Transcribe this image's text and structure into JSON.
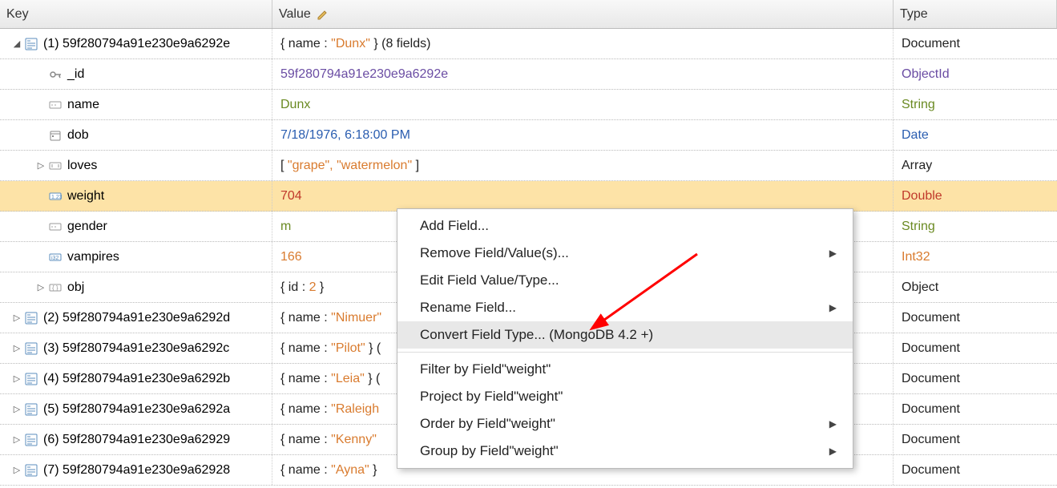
{
  "headers": {
    "key": "Key",
    "value": "Value",
    "type": "Type"
  },
  "rows": [
    {
      "kind": "doc",
      "expander": "down",
      "indent": 0,
      "icon": "doc",
      "key": "(1) 59f280794a91e230e9a6292e",
      "value_pre": "{ name : ",
      "value_q": "\"Dunx\"",
      "value_post": " } (8 fields)",
      "valColor": "txt-black",
      "type": "Document",
      "typeColor": "txt-black"
    },
    {
      "kind": "field",
      "expander": "",
      "indent": 1,
      "icon": "key",
      "key": "_id",
      "value": "59f280794a91e230e9a6292e",
      "valColor": "txt-purple",
      "type": "ObjectId",
      "typeColor": "txt-purple"
    },
    {
      "kind": "field",
      "expander": "",
      "indent": 1,
      "icon": "str",
      "key": "name",
      "value": "Dunx",
      "valColor": "txt-green",
      "type": "String",
      "typeColor": "txt-green"
    },
    {
      "kind": "field",
      "expander": "",
      "indent": 1,
      "icon": "date",
      "key": "dob",
      "value": "7/18/1976, 6:18:00 PM",
      "valColor": "txt-blue",
      "type": "Date",
      "typeColor": "txt-blue"
    },
    {
      "kind": "field",
      "expander": "right",
      "indent": 1,
      "icon": "arr",
      "key": "loves",
      "value_pre": "[ ",
      "value_q": "\"grape\", \"watermelon\"",
      "value_post": " ]",
      "valColor": "txt-black",
      "type": "Array",
      "typeColor": "txt-black"
    },
    {
      "kind": "field",
      "expander": "",
      "indent": 1,
      "icon": "num",
      "key": "weight",
      "value": "704",
      "valColor": "txt-red",
      "type": "Double",
      "typeColor": "txt-red",
      "highlight": true
    },
    {
      "kind": "field",
      "expander": "",
      "indent": 1,
      "icon": "str",
      "key": "gender",
      "value": "m",
      "valColor": "txt-green",
      "type": "String",
      "typeColor": "txt-green"
    },
    {
      "kind": "field",
      "expander": "",
      "indent": 1,
      "icon": "int",
      "key": "vampires",
      "value": "166",
      "valColor": "txt-orange",
      "type": "Int32",
      "typeColor": "txt-orange"
    },
    {
      "kind": "field",
      "expander": "right",
      "indent": 1,
      "icon": "obj",
      "key": "obj",
      "value_pre": "{ id : ",
      "value_q": "2",
      "value_post": " }",
      "valColor": "txt-black",
      "qColor": "txt-orange",
      "type": "Object",
      "typeColor": "txt-black"
    },
    {
      "kind": "doc",
      "expander": "right",
      "indent": 0,
      "icon": "doc",
      "key": "(2) 59f280794a91e230e9a6292d",
      "value_pre": "{ name : ",
      "value_q": "\"Nimuer\"",
      "value_post": "",
      "valColor": "txt-black",
      "type": "Document",
      "typeColor": "txt-black"
    },
    {
      "kind": "doc",
      "expander": "right",
      "indent": 0,
      "icon": "doc",
      "key": "(3) 59f280794a91e230e9a6292c",
      "value_pre": "{ name : ",
      "value_q": "\"Pilot\"",
      "value_post": " } (",
      "valColor": "txt-black",
      "type": "Document",
      "typeColor": "txt-black"
    },
    {
      "kind": "doc",
      "expander": "right",
      "indent": 0,
      "icon": "doc",
      "key": "(4) 59f280794a91e230e9a6292b",
      "value_pre": "{ name : ",
      "value_q": "\"Leia\"",
      "value_post": " } (",
      "valColor": "txt-black",
      "type": "Document",
      "typeColor": "txt-black"
    },
    {
      "kind": "doc",
      "expander": "right",
      "indent": 0,
      "icon": "doc",
      "key": "(5) 59f280794a91e230e9a6292a",
      "value_pre": "{ name : ",
      "value_q": "\"Raleigh",
      "value_post": "",
      "valColor": "txt-black",
      "type": "Document",
      "typeColor": "txt-black"
    },
    {
      "kind": "doc",
      "expander": "right",
      "indent": 0,
      "icon": "doc",
      "key": "(6) 59f280794a91e230e9a62929",
      "value_pre": "{ name : ",
      "value_q": "\"Kenny\"",
      "value_post": "",
      "valColor": "txt-black",
      "type": "Document",
      "typeColor": "txt-black"
    },
    {
      "kind": "doc",
      "expander": "right",
      "indent": 0,
      "icon": "doc",
      "key": "(7) 59f280794a91e230e9a62928",
      "value_pre": "{ name : ",
      "value_q": "\"Ayna\"",
      "value_post": " }",
      "valColor": "txt-black",
      "type": "Document",
      "typeColor": "txt-black"
    }
  ],
  "menu": {
    "items": [
      {
        "label": "Add Field...",
        "submenu": false
      },
      {
        "label": "Remove Field/Value(s)...",
        "submenu": true
      },
      {
        "label": "Edit Field Value/Type...",
        "submenu": false
      },
      {
        "label": "Rename Field...",
        "submenu": true
      },
      {
        "label": "Convert Field Type... (MongoDB 4.2 +)",
        "submenu": false,
        "hover": true
      },
      {
        "sep": true
      },
      {
        "label": "Filter by Field\"weight\"",
        "submenu": false
      },
      {
        "label": "Project by Field\"weight\"",
        "submenu": false
      },
      {
        "label": "Order by Field\"weight\"",
        "submenu": true
      },
      {
        "label": "Group by Field\"weight\"",
        "submenu": true
      }
    ]
  }
}
